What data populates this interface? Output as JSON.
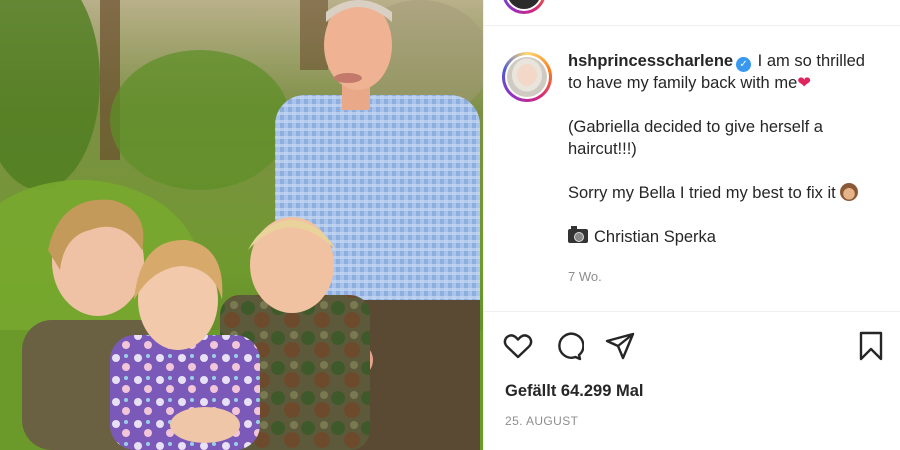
{
  "post": {
    "username": "hshprincesscharlene",
    "verified_symbol": "✓",
    "caption_line1": "I am so thrilled to have my family back with me",
    "caption_heart": "❤",
    "caption_para2": "(Gabriella decided to give herself a haircut!!!)",
    "caption_para3": "Sorry my Bella I tried my best to fix it",
    "caption_credit": "Christian Sperka",
    "age": "7 Wo.",
    "likes": "Gefällt 64.299 Mal",
    "date": "25. AUGUST"
  },
  "icons": {
    "like": "heart-outline-icon",
    "comment": "comment-bubble-icon",
    "share": "paper-plane-icon",
    "save": "bookmark-icon",
    "verified": "verified-badge-icon",
    "camera": "camera-emoji-icon",
    "monkey": "see-no-evil-monkey-emoji-icon"
  },
  "colors": {
    "text": "#262626",
    "muted": "#8e8e8e",
    "verified": "#3897f0",
    "heart": "#e0245e"
  }
}
